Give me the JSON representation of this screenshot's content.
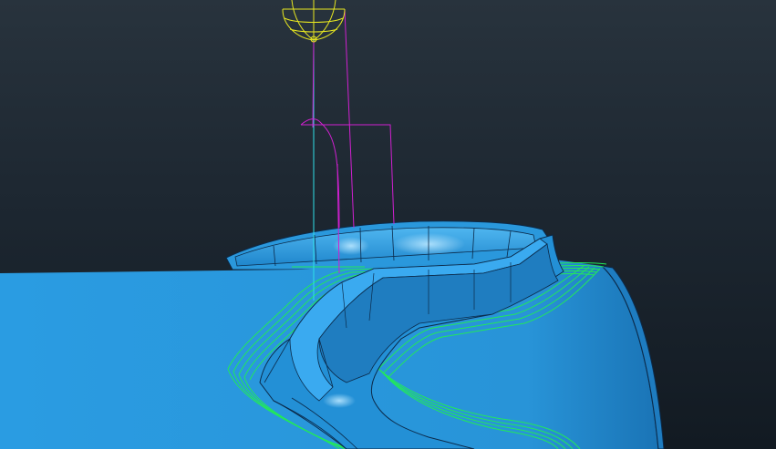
{
  "scene": {
    "model_fill": "#2b9be0",
    "model_fill_dark": "#1d7fc2",
    "model_edge": "#0b2a4a",
    "highlight": "#7fd0ff",
    "toolpath_color": "#22e85a",
    "tool_holder_color": "#e8e820",
    "tool_shank_color": "#d020d0",
    "tool_axis_color": "#30e0e8"
  }
}
